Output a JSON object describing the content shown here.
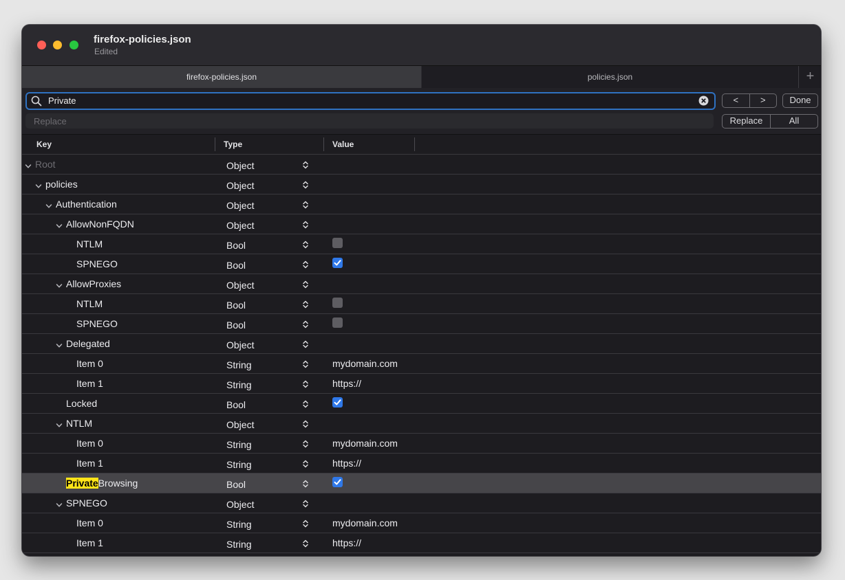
{
  "window": {
    "title": "firefox-policies.json",
    "subtitle": "Edited"
  },
  "tabs": [
    {
      "label": "firefox-policies.json",
      "active": true
    },
    {
      "label": "policies.json",
      "active": false
    }
  ],
  "tab_add_label": "+",
  "find": {
    "query": "Private",
    "replace_placeholder": "Replace",
    "prev_label": "<",
    "next_label": ">",
    "done_label": "Done",
    "replace_label": "Replace",
    "replace_all_label": "All"
  },
  "columns": {
    "key": "Key",
    "type": "Type",
    "value": "Value"
  },
  "colors": {
    "accent": "#2f72c2",
    "highlight": "#ffe418",
    "checkbox_on": "#2f78e8"
  },
  "rows": [
    {
      "key": "Root",
      "level": 0,
      "expandable": true,
      "dim": true,
      "type": "Object",
      "value_kind": "none"
    },
    {
      "key": "policies",
      "level": 1,
      "expandable": true,
      "type": "Object",
      "value_kind": "none"
    },
    {
      "key": "Authentication",
      "level": 2,
      "expandable": true,
      "type": "Object",
      "value_kind": "none"
    },
    {
      "key": "AllowNonFQDN",
      "level": 3,
      "expandable": true,
      "type": "Object",
      "value_kind": "none"
    },
    {
      "key": "NTLM",
      "level": 4,
      "expandable": false,
      "type": "Bool",
      "value_kind": "bool",
      "value": false
    },
    {
      "key": "SPNEGO",
      "level": 4,
      "expandable": false,
      "type": "Bool",
      "value_kind": "bool",
      "value": true
    },
    {
      "key": "AllowProxies",
      "level": 3,
      "expandable": true,
      "type": "Object",
      "value_kind": "none"
    },
    {
      "key": "NTLM",
      "level": 4,
      "expandable": false,
      "type": "Bool",
      "value_kind": "bool",
      "value": false
    },
    {
      "key": "SPNEGO",
      "level": 4,
      "expandable": false,
      "type": "Bool",
      "value_kind": "bool",
      "value": false
    },
    {
      "key": "Delegated",
      "level": 3,
      "expandable": true,
      "type": "Object",
      "value_kind": "none"
    },
    {
      "key": "Item 0",
      "level": 4,
      "expandable": false,
      "type": "String",
      "value_kind": "text",
      "value": "mydomain.com"
    },
    {
      "key": "Item 1",
      "level": 4,
      "expandable": false,
      "type": "String",
      "value_kind": "text",
      "value": "https://"
    },
    {
      "key": "Locked",
      "level": 3,
      "expandable": false,
      "type": "Bool",
      "value_kind": "bool",
      "value": true
    },
    {
      "key": "NTLM",
      "level": 3,
      "expandable": true,
      "type": "Object",
      "value_kind": "none"
    },
    {
      "key": "Item 0",
      "level": 4,
      "expandable": false,
      "type": "String",
      "value_kind": "text",
      "value": "mydomain.com"
    },
    {
      "key": "Item 1",
      "level": 4,
      "expandable": false,
      "type": "String",
      "value_kind": "text",
      "value": "https://"
    },
    {
      "key": "PrivateBrowsing",
      "key_match": "Private",
      "key_rest": "Browsing",
      "level": 3,
      "expandable": false,
      "selected": true,
      "type": "Bool",
      "value_kind": "bool",
      "value": true
    },
    {
      "key": "SPNEGO",
      "level": 3,
      "expandable": true,
      "type": "Object",
      "value_kind": "none"
    },
    {
      "key": "Item 0",
      "level": 4,
      "expandable": false,
      "type": "String",
      "value_kind": "text",
      "value": "mydomain.com"
    },
    {
      "key": "Item 1",
      "level": 4,
      "expandable": false,
      "type": "String",
      "value_kind": "text",
      "value": "https://"
    }
  ]
}
